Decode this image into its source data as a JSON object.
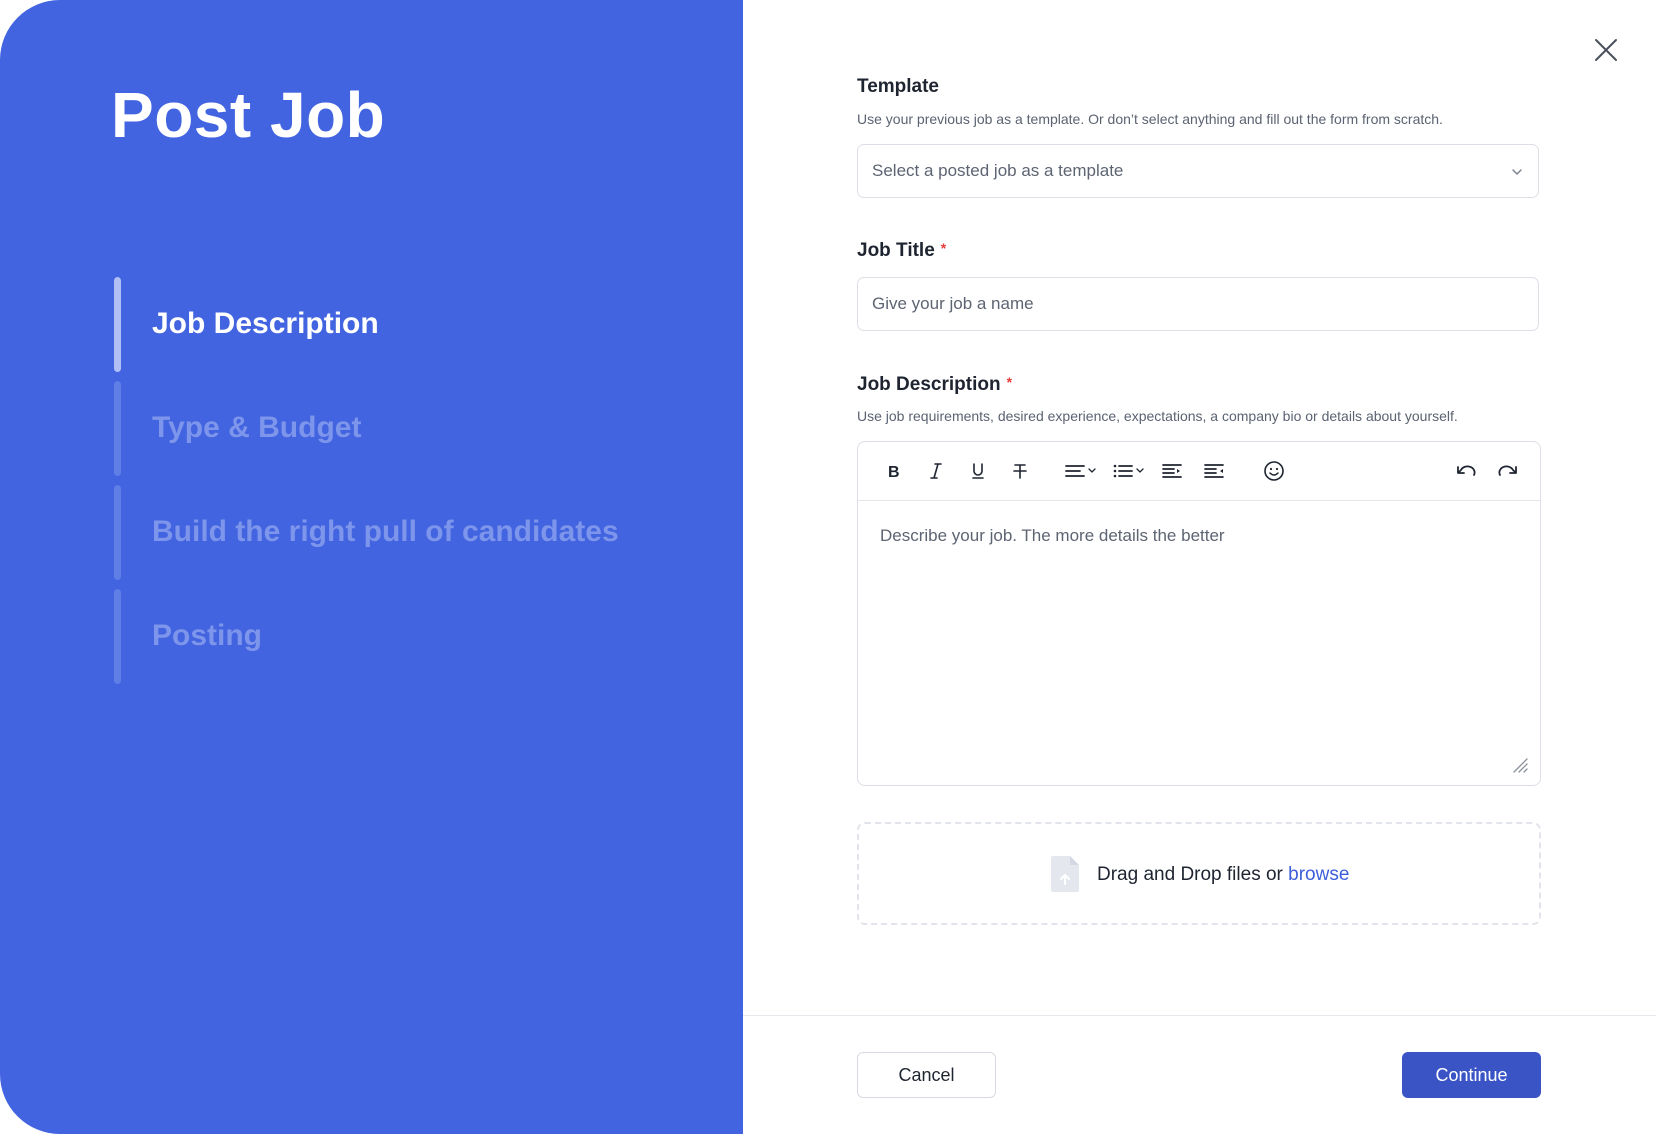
{
  "left_panel": {
    "title": "Post Job",
    "steps": [
      {
        "label": "Job Description",
        "active": true
      },
      {
        "label": "Type & Budget",
        "active": false
      },
      {
        "label": "Build the right pull of candidates",
        "active": false
      },
      {
        "label": "Posting",
        "active": false
      }
    ]
  },
  "form": {
    "template": {
      "label": "Template",
      "hint": "Use your previous job as a template. Or don’t select anything and fill out the form from scratch.",
      "placeholder": "Select a posted job as a template"
    },
    "job_title": {
      "label": "Job Title",
      "required_mark": "*",
      "placeholder": "Give your job a name"
    },
    "job_description": {
      "label": "Job Description",
      "required_mark": "*",
      "hint": "Use job requirements, desired experience, expectations, a company bio or details about yourself.",
      "placeholder": "Describe your job. The more details the better",
      "toolbar_icons": [
        "bold-icon",
        "italic-icon",
        "underline-icon",
        "strikethrough-icon",
        "align-icon",
        "list-icon",
        "indent-icon",
        "outdent-icon",
        "emoji-icon",
        "undo-icon",
        "redo-icon"
      ]
    },
    "dropzone": {
      "text": "Drag and Drop files or",
      "link": "browse"
    }
  },
  "footer": {
    "cancel": "Cancel",
    "continue": "Continue"
  },
  "colors": {
    "panel": "#4264e0",
    "primary_button": "#3a53c5",
    "link": "#3d5fd9",
    "required": "#e53b3b"
  }
}
